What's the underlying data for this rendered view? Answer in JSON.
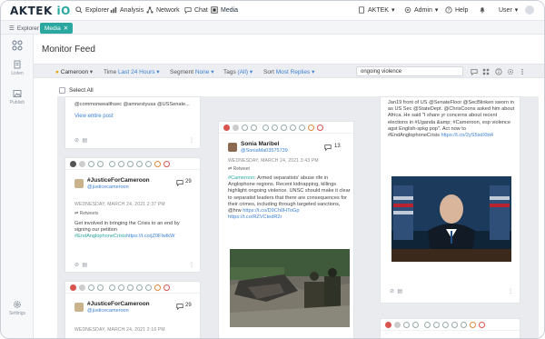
{
  "nav": {
    "brand": "AKTEK",
    "brand_suffix": "iO",
    "items": [
      {
        "label": "Explorer"
      },
      {
        "label": "Analysis"
      },
      {
        "label": "Network"
      },
      {
        "label": "Chat"
      },
      {
        "label": "Media"
      }
    ],
    "org": "AKTEK",
    "admin": "Admin",
    "help": "Help",
    "user": "User"
  },
  "tabs": {
    "explorer": "Explorer",
    "media": "Media"
  },
  "sidebar": {
    "listen": "Listen",
    "publish": "Publish",
    "settings": "Settings"
  },
  "page": {
    "title": "Monitor Feed"
  },
  "filters": {
    "keyword": "Cameroon",
    "time_label": "Time",
    "time_value": "Last 24 Hours",
    "segment_label": "Segment",
    "segment_value": "None",
    "tags_label": "Tags",
    "tags_value": "(All)",
    "sort_label": "Sort",
    "sort_value": "Most Replies",
    "search_value": "ongoing violence"
  },
  "select_all": "Select All",
  "cards": {
    "c1": {
      "text_top": "@commonwealthsec @amnestyusa @USSenate...",
      "view_more": "View entire post"
    },
    "c2": {
      "name": "#JusticeForCameroon",
      "handle": "@justicecameroon",
      "count": "29",
      "date": "WEDNESDAY, MARCH 24, 2021 2:37 PM",
      "retweets": "Retweets",
      "body_1": "Get involved in bringing the Crisis to an end by signing our petition",
      "body_tag": "#EndAnglophoneCrisis",
      "body_link": "https://t.co/jZ0FlwIkW"
    },
    "c3": {
      "name": "#JusticeForCameroon",
      "handle": "@justicecameroon",
      "count": "29",
      "date": "WEDNESDAY, MARCH 24, 2021 2:16 PM"
    },
    "c4": {
      "name": "Sonia Maribel",
      "handle": "@SoniaMa03575739",
      "count": "13",
      "date": "WEDNESDAY, MARCH 24, 2021 3:43 PM",
      "retweets": "Retweet",
      "body_tag": "#Cameroon",
      "body_1": ": Armed separatists' abuse rife in Anglophone regions. Recent kidnapping, killings highlight ongoing violence. UNSC should make it clear to separatist leaders that there are consequences for their crimes, including through targeted sanctions, @hrw",
      "body_link1": "https://t.co/D9Ch0HToGp",
      "body_link2": "https://t.co/RZVCtedR2r"
    },
    "c5": {
      "body": "Jan19 front of US @SenateFloor @SecBlinken sworn in as US Sec @StateDept. @ChrisCoons asked him about Africa. He said \"I share yr concerns about recent elections in #Uganda &amp; #Cameroon, esp violence agst English-spkg pop\". Act now to #EndAnglophoneCrisis",
      "link": "https://t.co/2yS5sdXbt4"
    }
  }
}
